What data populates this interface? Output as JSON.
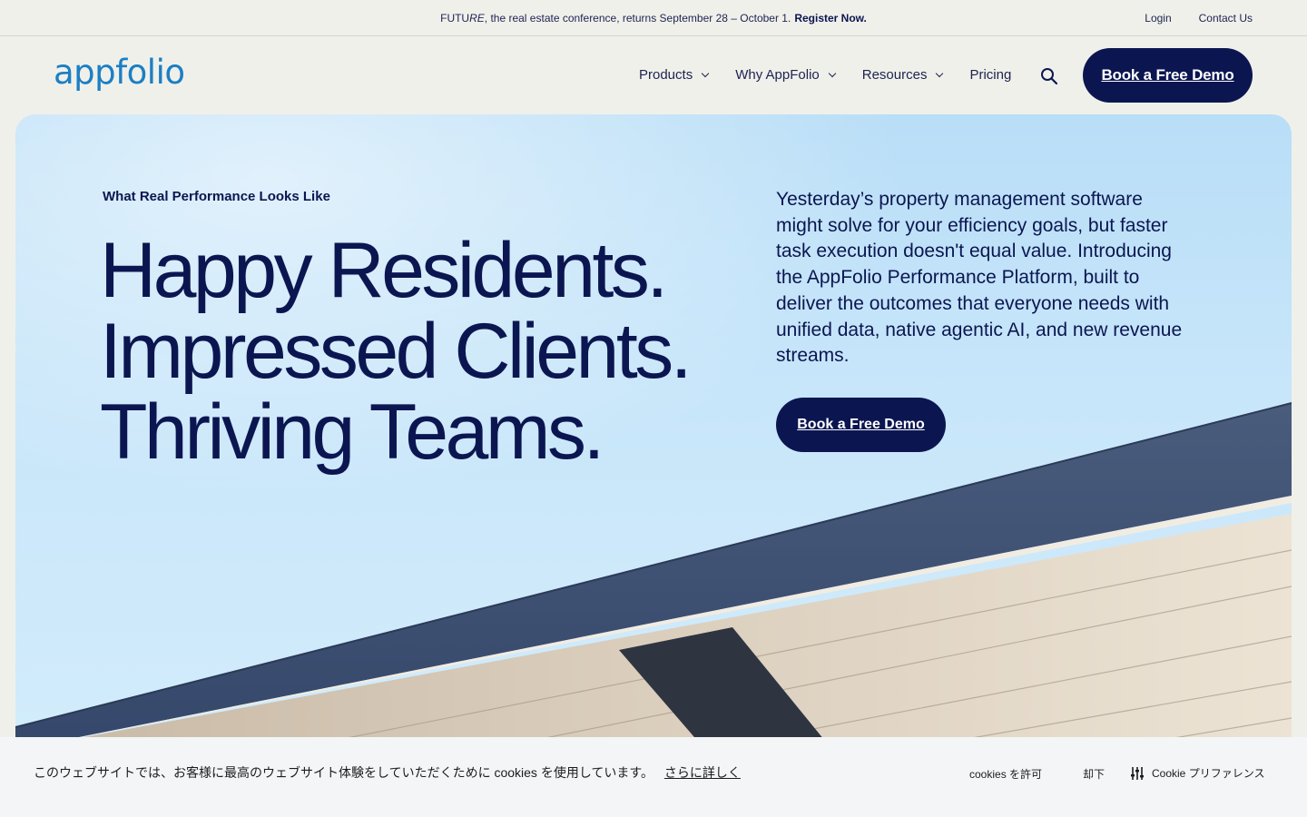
{
  "announcement": {
    "prefix": "FUTU",
    "prefix_italic": "RE",
    "message": ", the real estate conference, returns September 28 – October 1.",
    "register_label": "Register Now."
  },
  "utility_nav": {
    "login": "Login",
    "contact": "Contact Us"
  },
  "header": {
    "logo_text": "appfolio",
    "nav": [
      {
        "label": "Products",
        "has_dropdown": true
      },
      {
        "label": "Why AppFolio",
        "has_dropdown": true
      },
      {
        "label": "Resources",
        "has_dropdown": true
      },
      {
        "label": "Pricing",
        "has_dropdown": false
      }
    ],
    "search_icon": "search-icon",
    "cta_label": "Book a Free Demo"
  },
  "hero": {
    "eyebrow": "What Real Performance Looks Like",
    "headline": [
      "Happy Residents.",
      "Impressed Clients.",
      "Thriving Teams."
    ],
    "lead": "Yesterday’s property management software might solve for your efficiency goals, but faster task execution doesn't equal value. Introducing the AppFolio Performance Platform, built to deliver the outcomes that everyone needs with unified data, native agentic AI, and new revenue streams.",
    "cta_label": "Book a Free Demo"
  },
  "cookie_banner": {
    "text": "このウェブサイトでは、お客様に最高のウェブサイト体験をしていただくために cookies を使用しています。",
    "more_link": "さらに詳しく",
    "allow_label": "cookies を許可",
    "reject_label": "却下",
    "prefs_label": "Cookie プリファレンス",
    "prefs_icon": "sliders-icon"
  },
  "colors": {
    "navy": "#0b1651",
    "logo_blue": "#1b7fc4",
    "page_bg": "#f0f0ea",
    "sky": "#c8e6fa"
  }
}
